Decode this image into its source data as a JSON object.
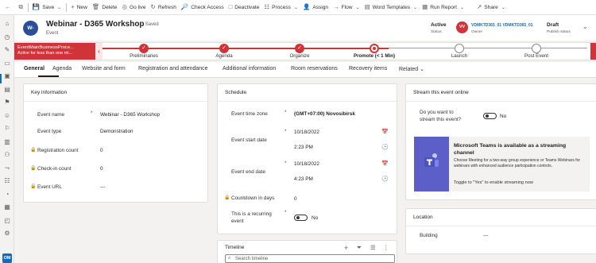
{
  "toolbar": {
    "items": [
      {
        "label": "Save",
        "icon": "save-icon",
        "glyph": "💾"
      },
      {
        "label": "New",
        "icon": "plus-icon",
        "glyph": "+"
      },
      {
        "label": "Delete",
        "icon": "delete-icon",
        "glyph": "🗑"
      },
      {
        "label": "Go live",
        "icon": "go-live-icon",
        "glyph": "◎"
      },
      {
        "label": "Refresh",
        "icon": "refresh-icon",
        "glyph": "↻"
      },
      {
        "label": "Check Access",
        "icon": "check-access-icon",
        "glyph": "🔎"
      },
      {
        "label": "Deactivate",
        "icon": "deactivate-icon",
        "glyph": "□"
      },
      {
        "label": "Process",
        "icon": "process-icon",
        "glyph": "☷"
      },
      {
        "label": "Assign",
        "icon": "assign-icon",
        "glyph": "👤"
      },
      {
        "label": "Flow",
        "icon": "flow-icon",
        "glyph": "→"
      },
      {
        "label": "Word Templates",
        "icon": "word-templates-icon",
        "glyph": "▤"
      },
      {
        "label": "Run Report",
        "icon": "run-report-icon",
        "glyph": "▦"
      },
      {
        "label": "Share",
        "icon": "share-icon",
        "glyph": "↗"
      }
    ]
  },
  "header": {
    "avatar_initials": "W-",
    "title": "Webinar - D365 Workshop",
    "saved_status": "- Saved",
    "entity_type": "Event",
    "status_value": "Active",
    "status_label": "Status",
    "owner_initials": "VV",
    "owner_name": "VDMKTD365_01 VDMKTD365_01",
    "owner_label": "Owner",
    "publish_value": "Draft",
    "publish_label": "Publish status"
  },
  "bpf": {
    "flag_title": "EventMainBusinessProce...",
    "flag_subtitle": "Active for less than one mi...",
    "stages": [
      {
        "label": "Preliminaries",
        "state": "done"
      },
      {
        "label": "Agenda",
        "state": "done"
      },
      {
        "label": "Organize",
        "state": "done"
      },
      {
        "label": "Promote  (< 1 Min)",
        "state": "active"
      },
      {
        "label": "Launch",
        "state": "todo"
      },
      {
        "label": "Post Event",
        "state": "todo"
      }
    ]
  },
  "tabs": [
    "General",
    "Agenda",
    "Website and form",
    "Registration and attendance",
    "Additional information",
    "Room reservations",
    "Recovery items",
    "Related"
  ],
  "key_info": {
    "title": "Key information",
    "event_name_label": "Event name",
    "event_name_value": "Webinar - D365 Workshop",
    "event_type_label": "Event type",
    "event_type_value": "Demonstration",
    "reg_count_label": "Registration count",
    "reg_count_value": "0",
    "checkin_label": "Check-in count",
    "checkin_value": "0",
    "url_label": "Event URL",
    "url_value": "---"
  },
  "schedule": {
    "title": "Schedule",
    "tz_label": "Event time zone",
    "tz_value": "(GMT+07:00) Novosibirsk",
    "start_label": "Event start date",
    "start_date": "10/18/2022",
    "start_time": "2:23 PM",
    "end_label": "Event end date",
    "end_date": "10/18/2022",
    "end_time": "4:23 PM",
    "countdown_label": "Countdown in days",
    "countdown_value": "0",
    "recurring_label_1": "This is a recurring",
    "recurring_label_2": "event",
    "recurring_value": "No"
  },
  "timeline": {
    "title": "Timeline",
    "search_placeholder": "Search timeline"
  },
  "stream": {
    "title": "Stream this event online",
    "question_1": "Do you want to",
    "question_2": "stream this event?",
    "toggle_value": "No",
    "teams_title": "Microsoft Teams is available as a streaming channel",
    "teams_desc": "Choose Meeting for a two-way group experience or Teams Webinars for webinars with enhanced audience participation controls.",
    "teams_note": "Toggle to \"Yes\" to enable streaming now"
  },
  "location": {
    "title": "Location",
    "building_label": "Building",
    "building_value": "---"
  },
  "nav": {
    "icons": [
      "home-icon",
      "recent-icon",
      "pinned-icon",
      "events-icon",
      "calendar-icon",
      "sessions-icon",
      "tracks-icon",
      "speakers-icon",
      "sponsors-icon",
      "registrations-icon",
      "attendees-icon",
      "journeys-icon",
      "forms-icon",
      "segments-icon",
      "venues-icon",
      "rooms-icon",
      "settings-icon"
    ],
    "badge": "OM"
  }
}
